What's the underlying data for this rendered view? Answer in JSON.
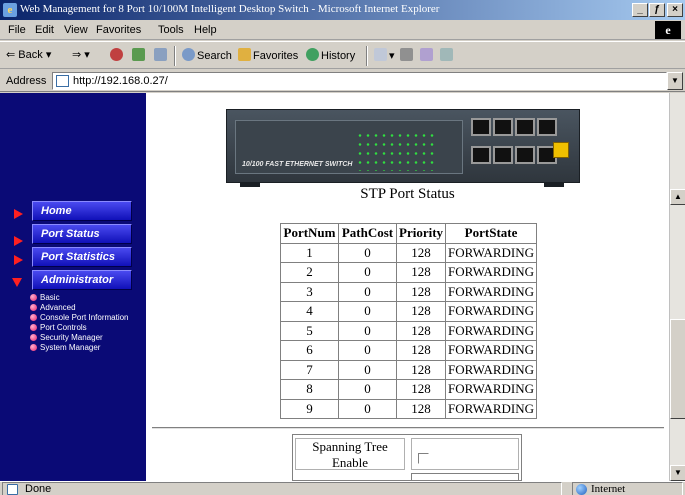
{
  "window": {
    "title": "Web Management for 8 Port 10/100M Intelligent Desktop Switch - Microsoft Internet Explorer",
    "min": "_",
    "max": "ƒ",
    "close": "×"
  },
  "menu": [
    "File",
    "Edit",
    "View",
    "Favorites",
    "Tools",
    "Help"
  ],
  "toolbar": {
    "back": "Back",
    "search": "Search",
    "favorites": "Favorites",
    "history": "History"
  },
  "address": {
    "label": "Address",
    "url": "http://192.168.0.27/"
  },
  "nav": {
    "buttons": [
      "Home",
      "Port Status",
      "Port Statistics",
      "Administrator"
    ],
    "submenu": [
      "Basic",
      "Advanced",
      "Console Port Information",
      "Port Controls",
      "Security Manager",
      "System Manager"
    ]
  },
  "device": {
    "model_label": "10/100 FAST ETHERNET SWITCH"
  },
  "main": {
    "heading": "STP Port Status",
    "columns": [
      "PortNum",
      "PathCost",
      "Priority",
      "PortState"
    ],
    "rows": [
      [
        "1",
        "0",
        "128",
        "FORWARDING"
      ],
      [
        "2",
        "0",
        "128",
        "FORWARDING"
      ],
      [
        "3",
        "0",
        "128",
        "FORWARDING"
      ],
      [
        "4",
        "0",
        "128",
        "FORWARDING"
      ],
      [
        "5",
        "0",
        "128",
        "FORWARDING"
      ],
      [
        "6",
        "0",
        "128",
        "FORWARDING"
      ],
      [
        "7",
        "0",
        "128",
        "FORWARDING"
      ],
      [
        "8",
        "0",
        "128",
        "FORWARDING"
      ],
      [
        "9",
        "0",
        "128",
        "FORWARDING"
      ]
    ],
    "spanning_tree_label": "Spanning Tree Enable",
    "spanning_tree_enabled": false
  },
  "status": {
    "left": "Done",
    "zone": "Internet"
  }
}
